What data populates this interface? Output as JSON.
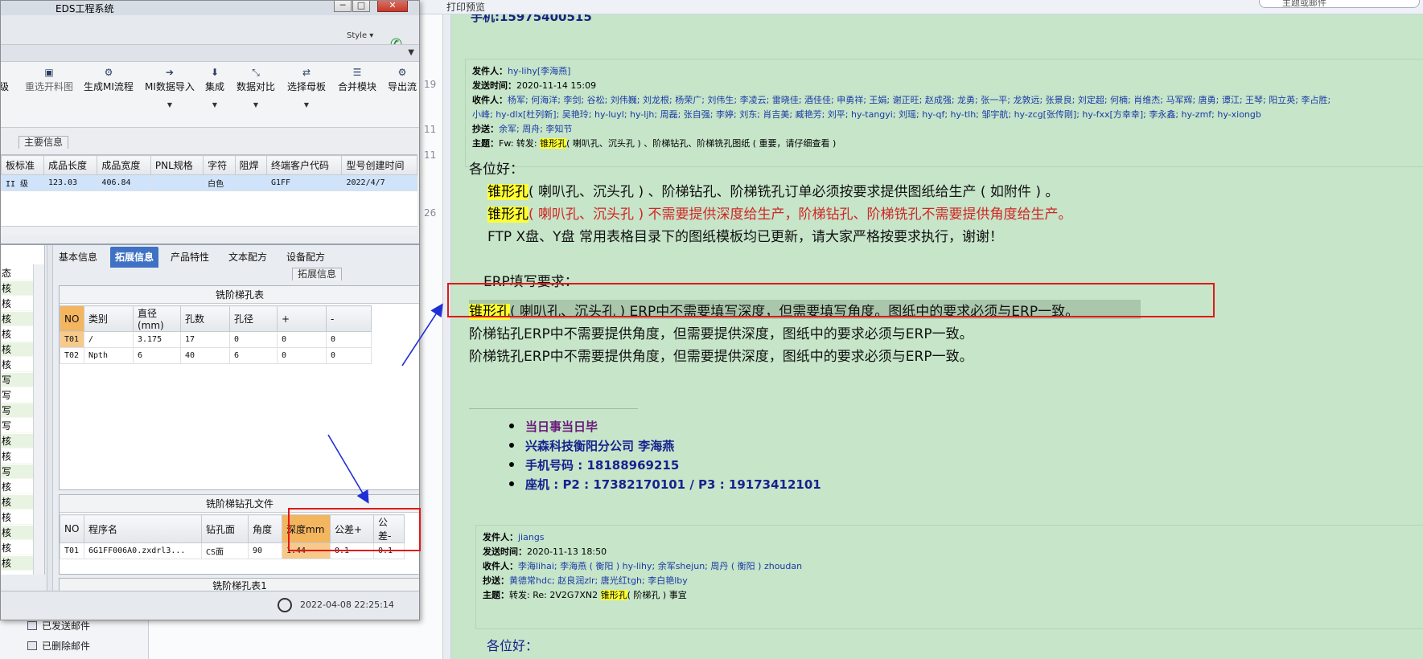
{
  "mail": {
    "toolbar_print": "打印预览",
    "search_placeholder": "主题或邮件",
    "sidebar": [
      "已发送邮件",
      "已删除邮件"
    ],
    "list_numbers": [
      "19",
      "11",
      "11",
      "26"
    ],
    "top_sender": "手机:15975400515",
    "email1": {
      "from_label": "发件人：",
      "from": "hy-lihy[李海燕]",
      "sent_label": "发送时间：",
      "sent": "2020-11-14 15:09",
      "to_label": "收件人：",
      "to_line1": "杨军; 何海洋; 李剑; 谷松; 刘伟巍; 刘龙根; 杨荣广; 刘伟生; 李凌云; 雷晓佳; 酒佳佳; 申勇祥; 王娟; 谢正旺; 赵成强; 龙勇; 张一平; 龙敦远; 张景良; 刘定超; 何楠; 肖维杰; 马军辉; 唐勇; 谭江; 王琴; 阳立英; 李占胜;",
      "to_line2": "小峰; hy-dlx[杜列新]; 吴艳玲; hy-luyl; hy-ljh; 周磊; 张自强; 李婷; 刘东; 肖吉美; 臧艳芳; 刘平; hy-tangyi; 刘瑶; hy-qf; hy-tlh; 邹宇航; hy-zcg[张传刚]; hy-fxx[方幸幸]; 李永鑫; hy-zmf; hy-xiongb",
      "cc_label": "抄送：",
      "cc": "余军; 周舟; 李知节",
      "subject_label": "主题：",
      "subject_prefix": "Fw: 转发:",
      "subject_hl": "锥形孔",
      "subject_rest": "( 喇叭孔、沉头孔 ) 、阶梯钻孔、阶梯铣孔图纸 ( 重要，请仔细查看 )"
    },
    "body": {
      "greeting": "各位好：",
      "l1_hl": "锥形孔",
      "l1": "( 喇叭孔、沉头孔 ) 、阶梯钻孔、阶梯铣孔订单必须按要求提供图纸给生产 ( 如附件 ) 。",
      "l2_hl": "锥形孔",
      "l2": "( 喇叭孔、沉头孔 ) 不需要提供深度给生产，阶梯钻孔、阶梯铣孔不需要提供角度给生产。",
      "l3": "FTP X盘、Y盘 常用表格目录下的图纸模板均已更新，请大家严格按要求执行，谢谢！",
      "erp_title": "ERP填写要求：",
      "erp1_hl": "锥形孔",
      "erp1": "( 喇叭孔、沉头孔 ) ERP中不需要填写深度，但需要填写角度。图纸中的要求必须与ERP一致。",
      "erp2": "阶梯钻孔ERP中不需要提供角度，但需要提供深度，图纸中的要求必须与ERP一致。",
      "erp3": "阶梯铣孔ERP中不需要提供角度，但需要提供深度，图纸中的要求必须与ERP一致。"
    },
    "signature": {
      "motto": "当日事当日毕",
      "company": "兴森科技衡阳分公司    李海燕",
      "mobile": "手机号码 : 18188969215",
      "phone": "座机 : P2 : 17382170101 / P3 : 19173412101"
    },
    "email2": {
      "from_label": "发件人：",
      "from": "jiangs",
      "sent_label": "发送时间：",
      "sent": "2020-11-13 18:50",
      "to_label": "收件人：",
      "to": "李海lihai; 李海燕 ( 衡阳 ) hy-lihy; 余军shejun; 周丹 ( 衡阳 ) zhoudan",
      "cc_label": "抄送：",
      "cc": "黄德常hdc; 赵良润zlr; 唐光红tgh; 李白艳lby",
      "subject_label": "主题：",
      "subject_prefix": "转发: Re: 2V2G7XN2",
      "subject_hl": "锥形孔",
      "subject_rest": "( 阶梯孔 ) 事宜",
      "greeting": "各位好："
    }
  },
  "eds": {
    "title": "EDS工程系统",
    "style_label": "Style",
    "ribbon": [
      {
        "label": "级",
        "icon": ""
      },
      {
        "label": "重选开料图",
        "icon": "image-icon"
      },
      {
        "label": "生成MI流程",
        "icon": "gears-icon"
      },
      {
        "label": "MI数据导入",
        "icon": "import-icon"
      },
      {
        "label": "集成",
        "icon": "download-icon"
      },
      {
        "label": "数据对比",
        "icon": "compare-icon"
      },
      {
        "label": "选择母板",
        "icon": "shuffle-icon"
      },
      {
        "label": "合并模块",
        "icon": "list-icon"
      },
      {
        "label": "导出流",
        "icon": "export-icon"
      }
    ],
    "main_info_caption": "主要信息",
    "grid1": {
      "headers": [
        "板标准",
        "成品长度",
        "成品宽度",
        "PNL规格",
        "字符",
        "阻焊",
        "终端客户代码",
        "型号创建时间"
      ],
      "row": [
        "II 级",
        "123.03",
        "406.84",
        "",
        "白色",
        "",
        "G1FF",
        "2022/4/7"
      ]
    },
    "left_list": [
      "态",
      "核",
      "核",
      "核",
      "核",
      "核",
      "核",
      "写",
      "写",
      "写",
      "写",
      "核",
      "核",
      "写",
      "核",
      "核",
      "核",
      "核",
      "核",
      "核",
      "核"
    ],
    "tabs": [
      "基本信息",
      "拓展信息",
      "产品特性",
      "文本配方",
      "设备配方"
    ],
    "ext_caption": "拓展信息",
    "mill_table": {
      "title": "铣阶梯孔表",
      "headers": [
        "NO",
        "类别",
        "直径(mm)",
        "孔数",
        "孔径",
        "+",
        "-"
      ],
      "rows": [
        [
          "T01",
          "/",
          "3.175",
          "17",
          "0",
          "0",
          "0"
        ],
        [
          "T02",
          "Npth",
          "6",
          "40",
          "6",
          "0",
          "0"
        ]
      ]
    },
    "drill_table": {
      "title": "铣阶梯钻孔文件",
      "headers": [
        "NO",
        "程序名",
        "钻孔面",
        "角度",
        "深度mm",
        "公差+",
        "公差-"
      ],
      "row": [
        "T01",
        "6G1FF006A0.zxdrl3...",
        "CS面",
        "90",
        "1.44",
        "0.1",
        "0.1"
      ]
    },
    "mill_table2_title": "铣阶梯孔表1",
    "status_time": "2022-04-08 22:25:14"
  }
}
